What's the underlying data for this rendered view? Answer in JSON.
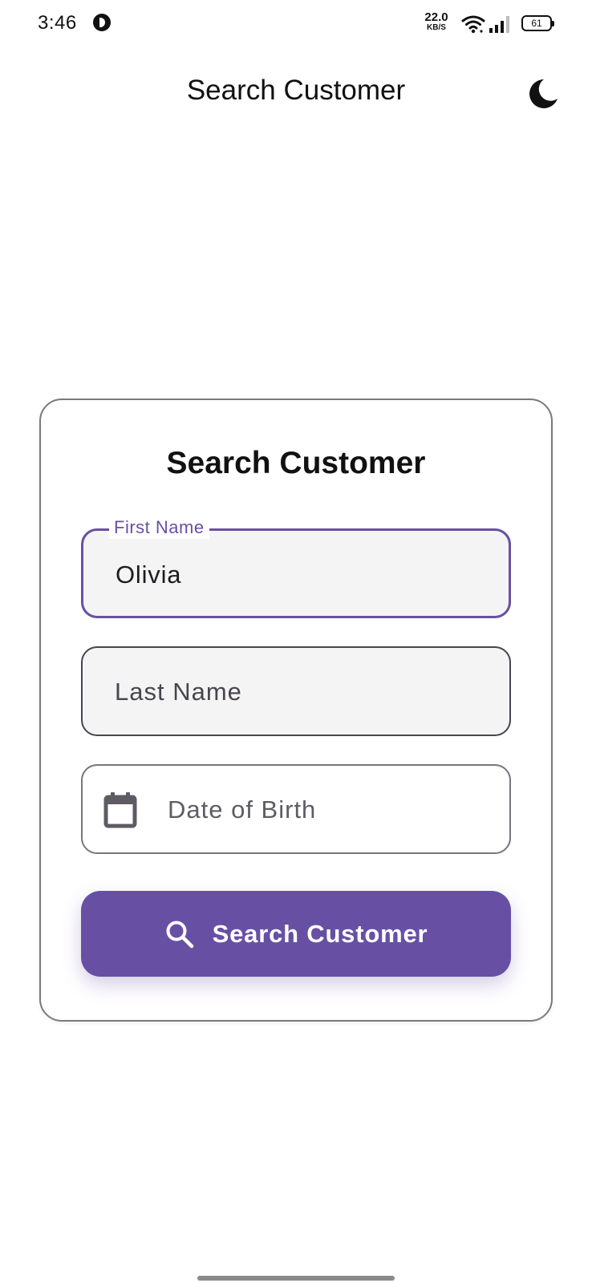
{
  "status_bar": {
    "time": "3:46",
    "net_speed_value": "22.0",
    "net_speed_unit": "KB/S",
    "battery": "61"
  },
  "app_bar": {
    "title": "Search Customer",
    "theme_toggle_icon": "dark-mode-moon-icon"
  },
  "form": {
    "title": "Search Customer",
    "first_name": {
      "label": "First Name",
      "value": "Olivia"
    },
    "last_name": {
      "placeholder": "Last Name"
    },
    "date_of_birth": {
      "placeholder": "Date of Birth",
      "icon": "calendar-icon"
    },
    "submit": {
      "label": "Search Customer",
      "icon": "search-icon"
    }
  },
  "colors": {
    "primary": "#6750a4",
    "field_fill": "#f4f4f5",
    "outline": "#79747e"
  }
}
